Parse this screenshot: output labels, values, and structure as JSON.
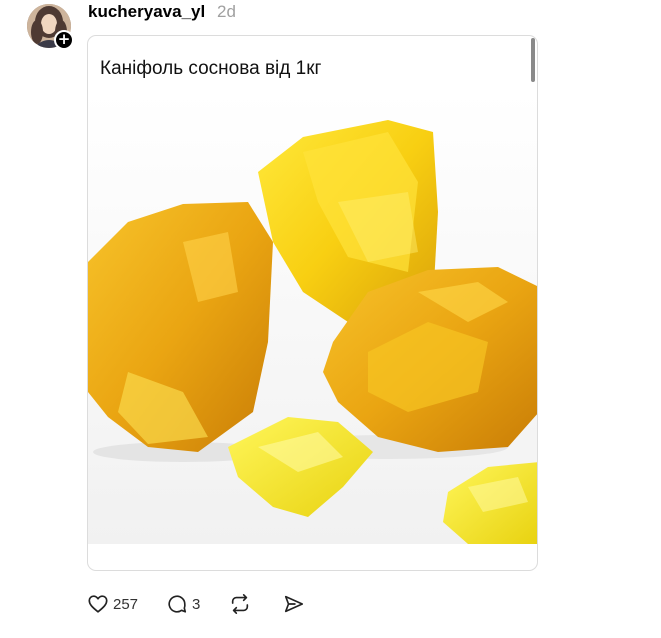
{
  "post": {
    "username": "kucheryava_yl",
    "time": "2d",
    "avatar_icon": "user-avatar",
    "follow_badge": "+"
  },
  "card": {
    "title": "Каніфоль соснова від 1кг",
    "price_partial": "",
    "image_subject": "yellow-pine-rosin-chunks"
  },
  "actions": {
    "like_icon": "heart-icon",
    "like_count": "257",
    "reply_icon": "comment-icon",
    "reply_count": "3",
    "repost_icon": "repost-icon",
    "share_icon": "send-icon"
  },
  "colors": {
    "rosin_main": "#f2b411",
    "rosin_light": "#ffe12a",
    "rosin_dark": "#d48a08",
    "muted_text": "#a0a0a0"
  }
}
